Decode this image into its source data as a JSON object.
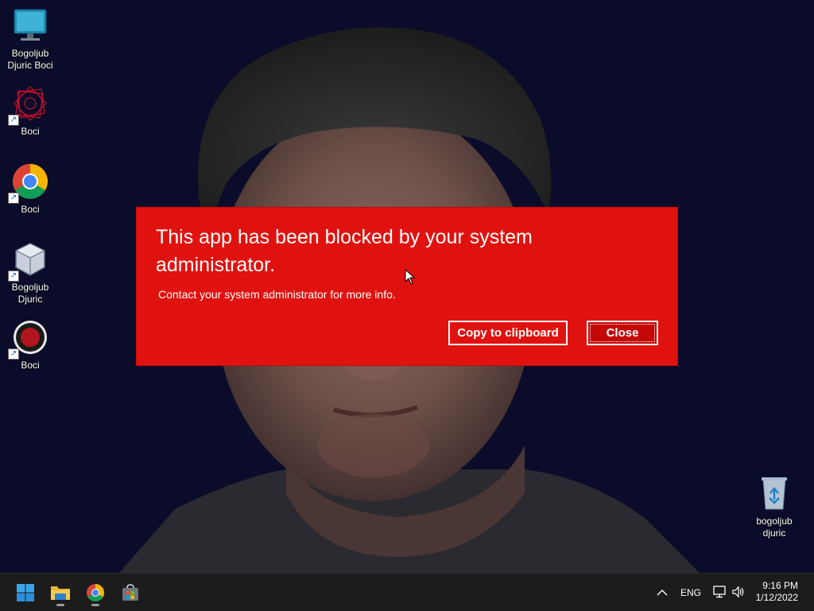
{
  "desktop": {
    "icons": [
      {
        "label": "Bogoljub Djuric Boci",
        "icon": "monitor-icon",
        "shortcut": false
      },
      {
        "label": "Boci",
        "icon": "red-geometric-icon",
        "shortcut": true
      },
      {
        "label": "Boci",
        "icon": "chrome-icon",
        "shortcut": true
      },
      {
        "label": "Bogoljub Djuric",
        "icon": "virtualbox-icon",
        "shortcut": true
      },
      {
        "label": "Boci",
        "icon": "record-icon",
        "shortcut": true
      },
      {
        "label": "bogoljub djuric",
        "icon": "recycle-bin-icon",
        "shortcut": false
      }
    ]
  },
  "dialog": {
    "title": "This app has been blocked by your system administrator.",
    "message": "Contact your system administrator for more info.",
    "copy_label": "Copy to clipboard",
    "close_label": "Close",
    "background": "#e0120f"
  },
  "taskbar": {
    "apps": [
      {
        "name": "Start",
        "icon": "windows-start-icon"
      },
      {
        "name": "File Explorer",
        "icon": "folder-icon"
      },
      {
        "name": "Google Chrome",
        "icon": "chrome-icon"
      },
      {
        "name": "Microsoft Store",
        "icon": "store-icon"
      }
    ],
    "tray": {
      "language": "ENG",
      "time": "9:16 PM",
      "date": "1/12/2022"
    }
  }
}
